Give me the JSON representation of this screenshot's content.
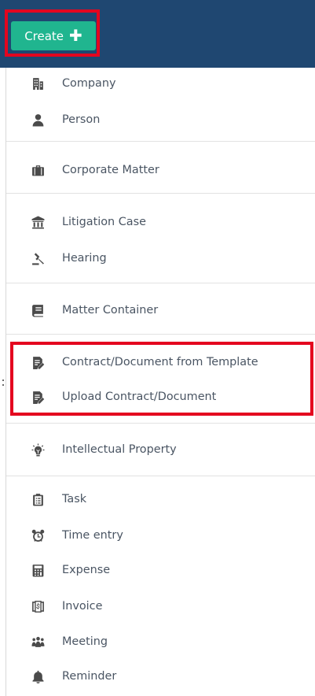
{
  "header": {
    "create_label": "Create",
    "create_icon": "plus-icon",
    "background": "#1f4771",
    "button_color": "#20b58f"
  },
  "highlight_color": "#e4061f",
  "menu": {
    "groups": [
      {
        "items": [
          {
            "name": "company",
            "label": "Company",
            "icon": "building-icon"
          },
          {
            "name": "person",
            "label": "Person",
            "icon": "person-icon"
          }
        ]
      },
      {
        "items": [
          {
            "name": "corporate-matter",
            "label": "Corporate Matter",
            "icon": "briefcase-icon"
          }
        ]
      },
      {
        "items": [
          {
            "name": "litigation-case",
            "label": "Litigation Case",
            "icon": "courthouse-icon"
          },
          {
            "name": "hearing",
            "label": "Hearing",
            "icon": "gavel-icon"
          }
        ]
      },
      {
        "items": [
          {
            "name": "matter-container",
            "label": "Matter Container",
            "icon": "book-icon"
          }
        ]
      },
      {
        "items": [
          {
            "name": "contract-from-template",
            "label": "Contract/Document from Template",
            "icon": "edit-document-icon"
          },
          {
            "name": "upload-contract",
            "label": "Upload Contract/Document",
            "icon": "edit-document-icon"
          }
        ]
      },
      {
        "items": [
          {
            "name": "intellectual-property",
            "label": "Intellectual Property",
            "icon": "lightbulb-icon"
          }
        ]
      },
      {
        "items": [
          {
            "name": "task",
            "label": "Task",
            "icon": "clipboard-icon"
          },
          {
            "name": "time-entry",
            "label": "Time entry",
            "icon": "alarm-clock-icon"
          },
          {
            "name": "expense",
            "label": "Expense",
            "icon": "calculator-icon"
          },
          {
            "name": "invoice",
            "label": "Invoice",
            "icon": "invoice-icon"
          },
          {
            "name": "meeting",
            "label": "Meeting",
            "icon": "group-icon"
          },
          {
            "name": "reminder",
            "label": "Reminder",
            "icon": "bell-icon"
          }
        ]
      }
    ]
  }
}
